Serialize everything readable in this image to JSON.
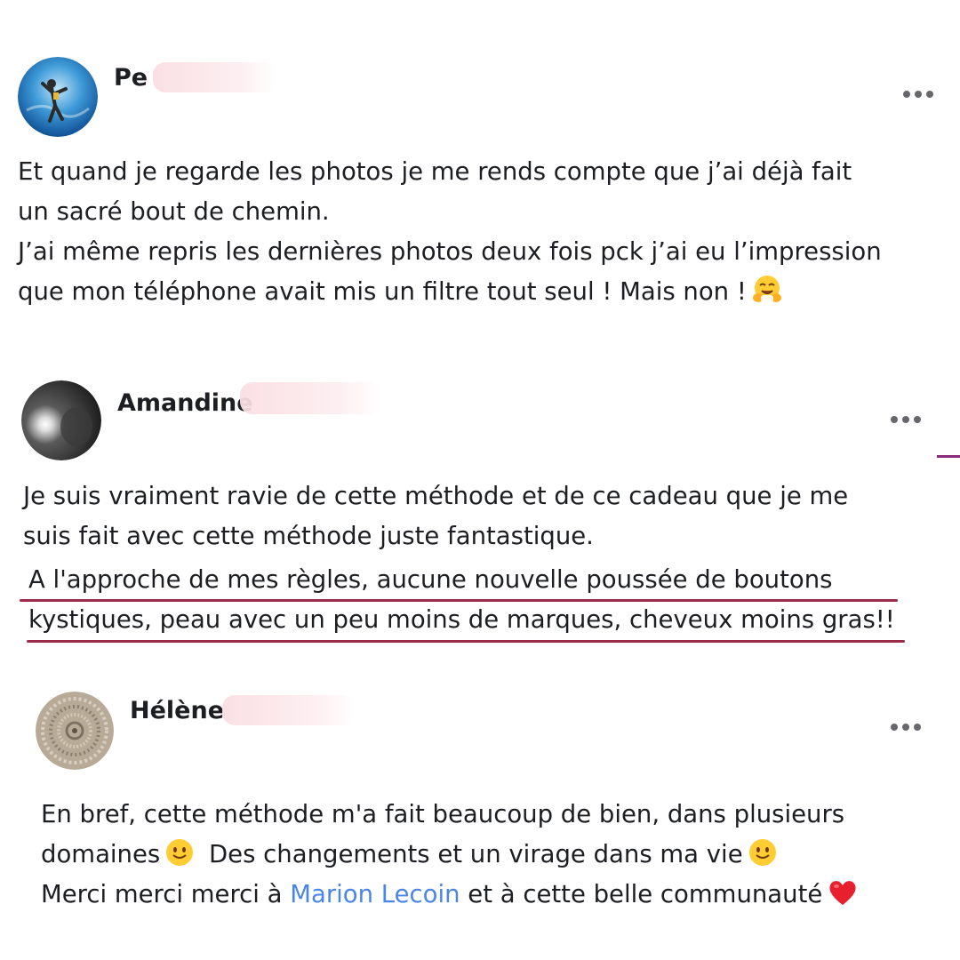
{
  "comments": [
    {
      "author": "Pe",
      "avatar_icon": "diver-avatar-icon",
      "more_icon": "more-options-icon",
      "lines": [
        "Et quand je regarde les photos je me rends compte que j’ai déjà fait",
        "un sacré bout de chemin.",
        "J’ai même repris les dernières photos deux fois pck j’ai eu l’impression",
        "que mon téléphone avait mis un filtre tout seul ! Mais non !"
      ],
      "trailing_emoji": "hugging-face-emoji"
    },
    {
      "author": "Amandine",
      "avatar_icon": "dark-photo-avatar-icon",
      "more_icon": "more-options-icon",
      "lines": [
        "Je suis vraiment ravie de cette méthode et de ce cadeau que je me",
        "suis fait avec cette méthode juste fantastique."
      ],
      "highlighted_lines": [
        "A l'approche de mes règles, aucune nouvelle poussée de boutons",
        "kystiques, peau avec un peu moins de marques, cheveux moins gras!!"
      ],
      "highlight_color": "#9c2a4a"
    },
    {
      "author": "Hélène",
      "avatar_icon": "spiral-avatar-icon",
      "more_icon": "more-options-icon",
      "line1": "En bref, cette méthode m'a fait beaucoup de bien, dans plusieurs",
      "line2_a": "domaines",
      "line2_b": "Des changements et un virage dans ma vie",
      "line3_a": "Merci merci merci à ",
      "line3_link": "Marion Lecoin",
      "line3_b": " et à cette belle communauté",
      "link_color": "#4a86e8",
      "emojis": [
        "smiling-face-emoji",
        "smiling-face-emoji",
        "red-heart-emoji"
      ]
    }
  ]
}
